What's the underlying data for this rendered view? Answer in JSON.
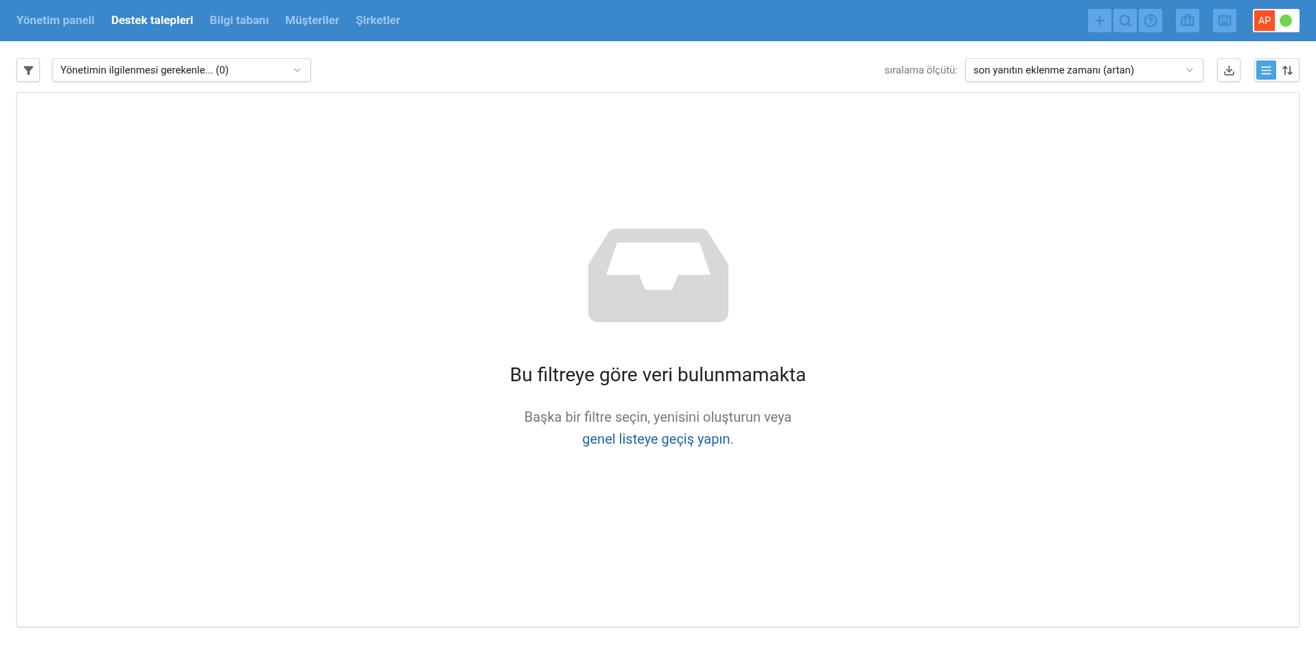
{
  "nav": [
    {
      "label": "Yönetim paneli",
      "selected": false
    },
    {
      "label": "Destek talepleri",
      "selected": true
    },
    {
      "label": "Bilgi tabanı",
      "selected": false
    },
    {
      "label": "Müşteriler",
      "selected": false
    },
    {
      "label": "Şirketler",
      "selected": false
    }
  ],
  "header_actions": [
    {
      "kind": "plus"
    },
    {
      "kind": "search"
    },
    {
      "kind": "help"
    },
    {
      "kind": "briefcase"
    },
    {
      "kind": "keyboard"
    }
  ],
  "user": {
    "initials": "AP",
    "online": true
  },
  "filter": {
    "value": "Yönetimin ilgilenmesi gerekenle... (0)"
  },
  "sort": {
    "label": "sıralama ölçütü:",
    "value": "son yanıtın eklenme zamanı (artan)"
  },
  "view_modes": [
    {
      "kind": "list",
      "selected": true
    },
    {
      "kind": "compact",
      "selected": false
    }
  ],
  "empty_state": {
    "title": "Bu filtreye göre veri bulunmamakta",
    "text_before": "Başka bir filtre seçin, yenisini oluşturun veya",
    "link": "genel listeye geçiş yapın",
    "text_after": "."
  }
}
